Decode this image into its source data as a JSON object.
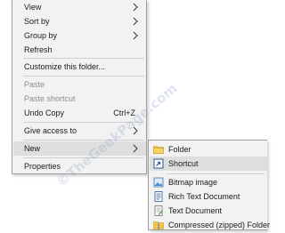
{
  "main_menu": {
    "view": "View",
    "sort_by": "Sort by",
    "group_by": "Group by",
    "refresh": "Refresh",
    "customize": "Customize this folder...",
    "paste": "Paste",
    "paste_shortcut": "Paste shortcut",
    "undo_copy": "Undo Copy",
    "undo_copy_shortcut": "Ctrl+Z",
    "give_access": "Give access to",
    "new": "New",
    "properties": "Properties"
  },
  "new_submenu": {
    "folder": "Folder",
    "shortcut": "Shortcut",
    "bitmap": "Bitmap image",
    "rtf": "Rich Text Document",
    "text": "Text Document",
    "zip": "Compressed (zipped) Folder"
  },
  "watermark": "©TheGeekPage.com",
  "colors": {
    "menu_bg": "#f2f2f2",
    "highlight": "#dedede",
    "disabled_text": "#8c8c8c",
    "folder": "#f4c542"
  }
}
